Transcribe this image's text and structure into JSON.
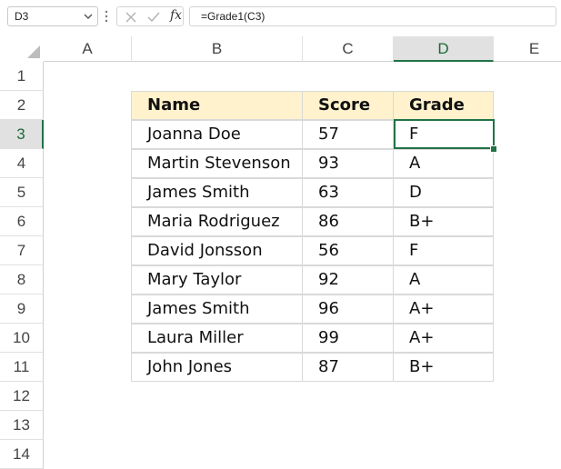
{
  "formula_bar": {
    "name_box": "D3",
    "cancel_icon": "close-icon",
    "enter_icon": "check-icon",
    "function_icon": "fx",
    "formula": "=Grade1(C3)"
  },
  "columns": [
    "A",
    "B",
    "C",
    "D",
    "E"
  ],
  "selected_column": "D",
  "rows": [
    "1",
    "2",
    "3",
    "4",
    "5",
    "6",
    "7",
    "8",
    "9",
    "10",
    "11",
    "12",
    "13",
    "14"
  ],
  "selected_row": "3",
  "table": {
    "headers": [
      "Name",
      "Score",
      "Grade"
    ],
    "rows": [
      [
        "Joanna Doe",
        "57",
        "F"
      ],
      [
        "Martin Stevenson",
        "93",
        "A"
      ],
      [
        "James Smith",
        "63",
        "D"
      ],
      [
        "Maria Rodriguez",
        "86",
        "B+"
      ],
      [
        "David Jonsson",
        "56",
        "F"
      ],
      [
        "Mary Taylor",
        "92",
        "A"
      ],
      [
        "James Smith",
        "96",
        "A+"
      ],
      [
        "Laura Miller",
        "99",
        "A+"
      ],
      [
        "John Jones",
        "87",
        "B+"
      ]
    ]
  },
  "colors": {
    "header_fill": "#fff2cc",
    "selection": "#217346"
  }
}
